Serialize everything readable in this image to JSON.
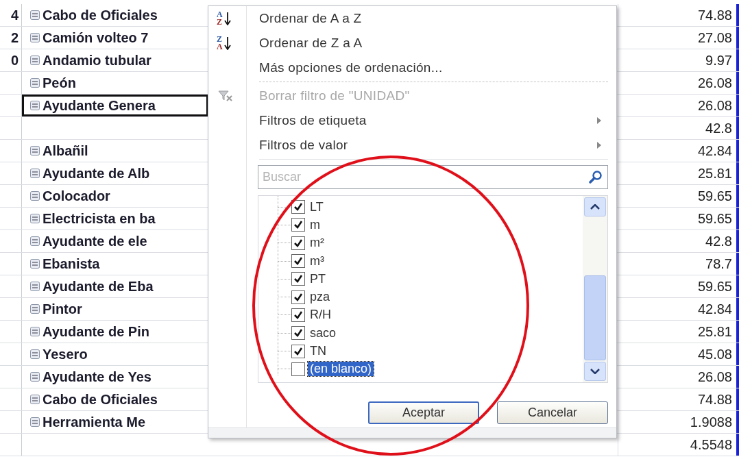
{
  "sheet": {
    "rows": [
      {
        "col_a": "4",
        "name": "Cabo de Oficiales",
        "value": "74.88",
        "active": false
      },
      {
        "col_a": "2",
        "name": "Camión volteo 7",
        "value": "27.08",
        "active": false
      },
      {
        "col_a": "0",
        "name": "Andamio tubular",
        "value": "9.97",
        "active": false
      },
      {
        "name": "Peón",
        "value": "26.08",
        "active": false
      },
      {
        "name": "Ayudante Genera",
        "value": "26.08",
        "active": true
      },
      {
        "value": "42.8",
        "active": false
      },
      {
        "name": "Albañil",
        "value": "42.84",
        "active": false
      },
      {
        "name": "Ayudante de Alb",
        "value": "25.81",
        "active": false
      },
      {
        "name": "Colocador",
        "value": "59.65",
        "active": false
      },
      {
        "name": "Electricista en ba",
        "value": "59.65",
        "active": false
      },
      {
        "name": "Ayudante de ele",
        "value": "42.8",
        "active": false
      },
      {
        "name": "Ebanista",
        "value": "78.7",
        "active": false
      },
      {
        "name": "Ayudante de Eba",
        "value": "59.65",
        "active": false
      },
      {
        "name": "Pintor",
        "value": "42.84",
        "active": false
      },
      {
        "name": "Ayudante de Pin",
        "value": "25.81",
        "active": false
      },
      {
        "name": "Yesero",
        "value": "45.08",
        "active": false
      },
      {
        "name": "Ayudante de Yes",
        "value": "26.08",
        "active": false
      },
      {
        "name": "Cabo de Oficiales",
        "value": "74.88",
        "active": false
      },
      {
        "name": "Herramienta Me",
        "value": "1.9088",
        "active": false
      },
      {
        "value": "4.5548",
        "active": false
      }
    ]
  },
  "filter_menu": {
    "items": [
      {
        "kind": "sort",
        "icon_letters": [
          "A",
          "Z"
        ],
        "label": "Ordenar de A a Z",
        "disabled": false
      },
      {
        "kind": "sort",
        "icon_letters": [
          "Z",
          "A"
        ],
        "label": "Ordenar de Z a A",
        "disabled": false
      },
      {
        "kind": "item",
        "label": "Más opciones de ordenación...",
        "disabled": false
      },
      {
        "kind": "separator"
      },
      {
        "kind": "clear",
        "label": "Borrar filtro de \"UNIDAD\"",
        "disabled": true
      },
      {
        "kind": "submenu",
        "label": "Filtros de etiqueta",
        "disabled": false
      },
      {
        "kind": "submenu",
        "label": "Filtros de valor",
        "disabled": false
      },
      {
        "kind": "separator"
      }
    ],
    "search": {
      "placeholder": "Buscar"
    },
    "values": [
      {
        "label": "LT",
        "checked": true,
        "selected": false
      },
      {
        "label": "m",
        "checked": true,
        "selected": false
      },
      {
        "label": "m²",
        "checked": true,
        "selected": false
      },
      {
        "label": "m³",
        "checked": true,
        "selected": false
      },
      {
        "label": "PT",
        "checked": true,
        "selected": false
      },
      {
        "label": "pza",
        "checked": true,
        "selected": false
      },
      {
        "label": "R/H",
        "checked": true,
        "selected": false
      },
      {
        "label": "saco",
        "checked": true,
        "selected": false
      },
      {
        "label": "TN",
        "checked": true,
        "selected": false
      },
      {
        "label": "(en blanco)",
        "checked": false,
        "selected": true
      }
    ],
    "buttons": [
      {
        "label": "Aceptar",
        "focused": true
      },
      {
        "label": "Cancelar",
        "focused": false
      }
    ]
  }
}
